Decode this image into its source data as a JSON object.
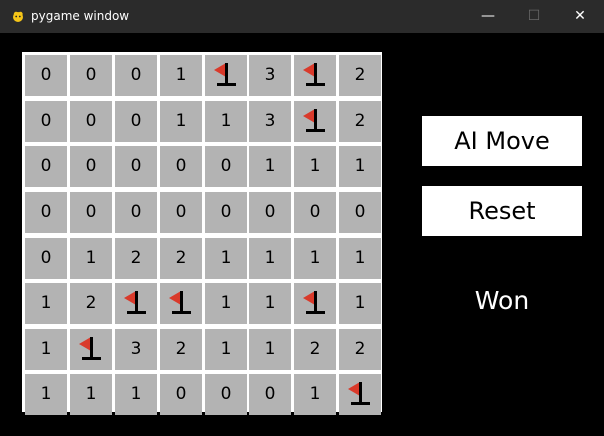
{
  "window": {
    "title": "pygame window",
    "controls": {
      "minimize": "—",
      "maximize": "☐",
      "close": "✕"
    }
  },
  "board": {
    "rows": [
      [
        "0",
        "0",
        "0",
        "1",
        "F",
        "3",
        "F",
        "2"
      ],
      [
        "0",
        "0",
        "0",
        "1",
        "1",
        "3",
        "F",
        "2"
      ],
      [
        "0",
        "0",
        "0",
        "0",
        "0",
        "1",
        "1",
        "1"
      ],
      [
        "0",
        "0",
        "0",
        "0",
        "0",
        "0",
        "0",
        "0"
      ],
      [
        "0",
        "1",
        "2",
        "2",
        "1",
        "1",
        "1",
        "1"
      ],
      [
        "1",
        "2",
        "F",
        "F",
        "1",
        "1",
        "F",
        "1"
      ],
      [
        "1",
        "F",
        "3",
        "2",
        "1",
        "1",
        "2",
        "2"
      ],
      [
        "1",
        "1",
        "1",
        "0",
        "0",
        "0",
        "1",
        "F"
      ]
    ]
  },
  "buttons": {
    "ai_move": "AI Move",
    "reset": "Reset"
  },
  "status": "Won",
  "colors": {
    "cell": "#b3b3b3",
    "grid": "#ffffff",
    "flag": "#d93a2b",
    "background": "#000000",
    "titlebar": "#2b2b2b"
  },
  "icons": {
    "app": "pygame-snake-icon",
    "flag": "flag-icon"
  }
}
